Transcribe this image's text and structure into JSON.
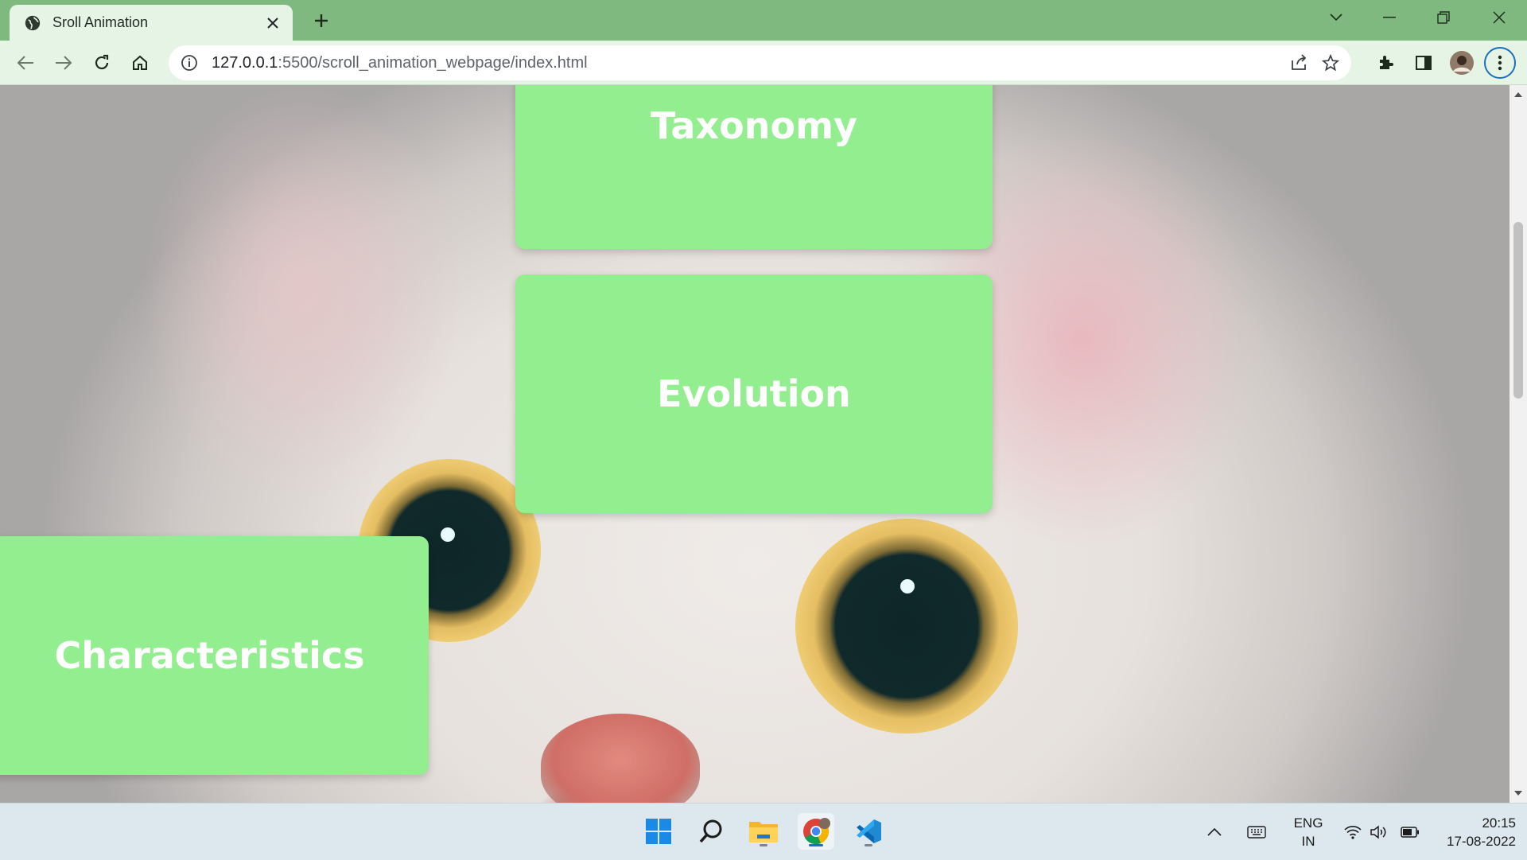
{
  "browser": {
    "tab": {
      "title": "Sroll Animation"
    },
    "address": {
      "host": "127.0.0.1",
      "path": ":5500/scroll_animation_webpage/index.html"
    }
  },
  "page": {
    "cards": [
      {
        "label": "Taxonomy"
      },
      {
        "label": "Evolution"
      },
      {
        "label": "Characteristics"
      }
    ],
    "background": "cat close-up photo"
  },
  "taskbar": {
    "language": {
      "line1": "ENG",
      "line2": "IN"
    },
    "clock": {
      "time": "20:15",
      "date": "17-08-2022"
    }
  },
  "colors": {
    "card": "#93ee8f",
    "chrome_tabstrip": "#80b97f",
    "chrome_toolbar": "#e6f4e5"
  }
}
